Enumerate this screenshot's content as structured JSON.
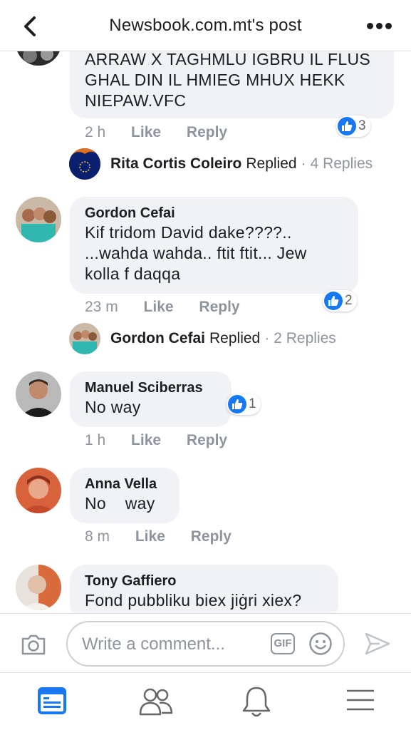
{
  "header": {
    "title": "Newsbook.com.mt's post"
  },
  "comments": [
    {
      "text": "ARRAW X TAGHMLU IGBRU IL FLUS GHAL DIN IL HMIEG MHUX HEKK NIEPAW.VFC",
      "time": "2 h",
      "like_label": "Like",
      "reply_label": "Reply",
      "reactions": "3",
      "replies": {
        "name": "Rita Cortis Coleiro",
        "replied": "Replied",
        "dot": "·",
        "count": "4 Replies"
      }
    },
    {
      "author": "Gordon Cefai",
      "text": "Kif tridom David dake????.. ...wahda wahda.. ftit ftit... Jew kolla f daqqa",
      "time": "23 m",
      "like_label": "Like",
      "reply_label": "Reply",
      "reactions": "2",
      "replies": {
        "name": "Gordon Cefai",
        "replied": "Replied",
        "dot": "·",
        "count": "2 Replies"
      }
    },
    {
      "author": "Manuel Sciberras",
      "text": "No way",
      "time": "1 h",
      "like_label": "Like",
      "reply_label": "Reply",
      "reactions": "1"
    },
    {
      "author": "Anna Vella",
      "text": "No    way",
      "time": "8 m",
      "like_label": "Like",
      "reply_label": "Reply"
    },
    {
      "author": "Tony Gaffiero",
      "text": "Fond pubbliku biex jiġri xiex?"
    }
  ],
  "composer": {
    "placeholder": "Write a comment...",
    "gif_label": "GIF"
  },
  "tabs": [
    {
      "icon": "news-feed-icon",
      "active": true
    },
    {
      "icon": "friends-icon",
      "active": false
    },
    {
      "icon": "notifications-icon",
      "active": false
    },
    {
      "icon": "menu-icon",
      "active": false
    }
  ],
  "colors": {
    "accent": "#1877f2",
    "bubble": "#f0f2f5",
    "meta_text": "#8d949e"
  }
}
